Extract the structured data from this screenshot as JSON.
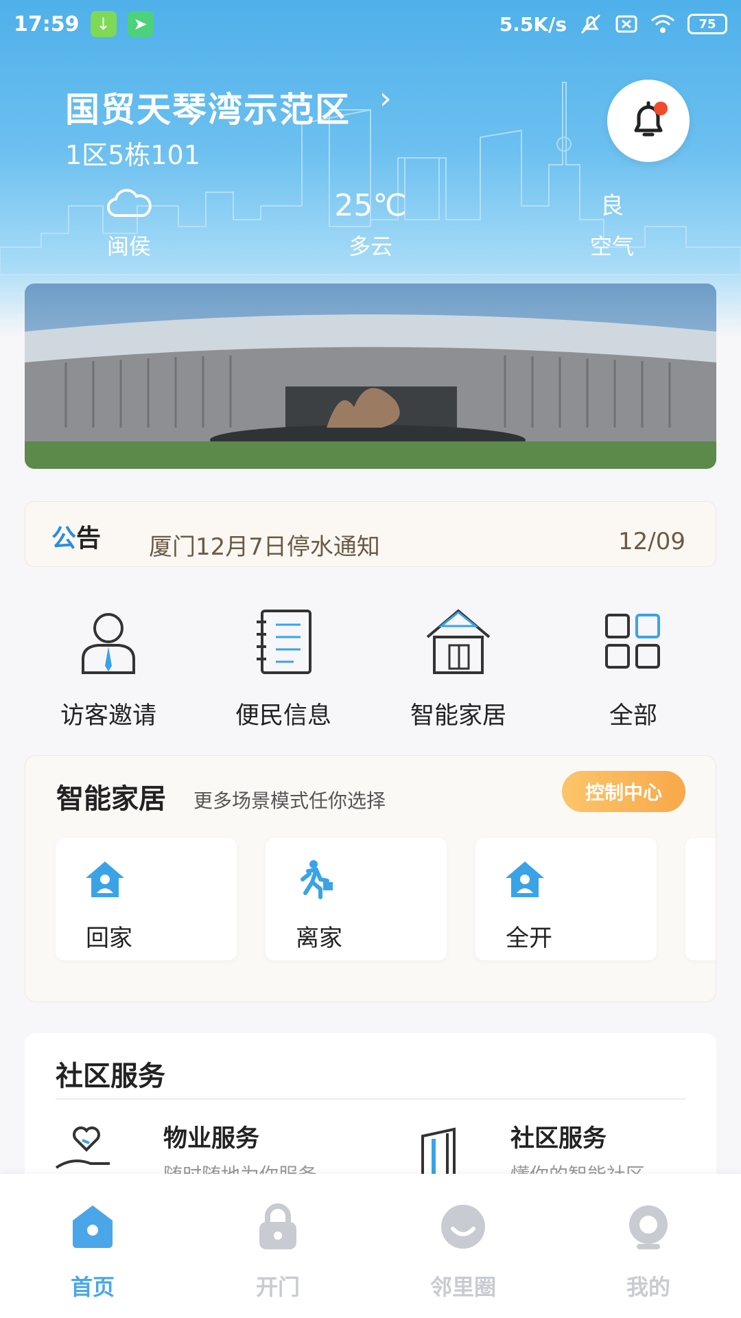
{
  "status_bar": {
    "time": "17:59",
    "net_speed": "5.5K/s",
    "battery": "75"
  },
  "header": {
    "community_name": "国贸天琴湾示范区",
    "unit": "1区5栋101"
  },
  "weather": {
    "location": "闽侯",
    "temperature": "25℃",
    "condition": "多云",
    "air_quality": "良",
    "air_label": "空气"
  },
  "notice": {
    "label_part1": "公",
    "label_part2": "告",
    "text": "厦门12月7日停水通知",
    "date": "12/09"
  },
  "quick_actions": [
    {
      "label": "访客邀请",
      "icon": "visitor-icon"
    },
    {
      "label": "便民信息",
      "icon": "notebook-icon"
    },
    {
      "label": "智能家居",
      "icon": "house-icon"
    },
    {
      "label": "全部",
      "icon": "grid-icon"
    }
  ],
  "smart_home": {
    "title": "智能家居",
    "subtitle": "更多场景模式任你选择",
    "control_button": "控制中心",
    "scenes": [
      {
        "label": "回家",
        "icon": "home-person-icon"
      },
      {
        "label": "离家",
        "icon": "running-person-icon"
      },
      {
        "label": "全开",
        "icon": "home-person-icon"
      }
    ]
  },
  "services": {
    "title": "社区服务",
    "items": [
      {
        "title": "物业服务",
        "subtitle": "随时随地为你服务",
        "icon": "heart-hand-icon"
      },
      {
        "title": "社区服务",
        "subtitle": "懂你的智能社区",
        "icon": "door-icon"
      }
    ]
  },
  "tabs": [
    {
      "label": "首页",
      "icon": "home-tab-icon",
      "active": true
    },
    {
      "label": "开门",
      "icon": "lock-tab-icon",
      "active": false
    },
    {
      "label": "邻里圈",
      "icon": "smile-tab-icon",
      "active": false
    },
    {
      "label": "我的",
      "icon": "profile-tab-icon",
      "active": false
    }
  ],
  "colors": {
    "accent": "#2a8de0",
    "header_blue": "#4fb0ea",
    "control_orange": "#f8a84a",
    "tab_active": "#4aa6e8",
    "tab_inactive": "#c8cbd1"
  }
}
